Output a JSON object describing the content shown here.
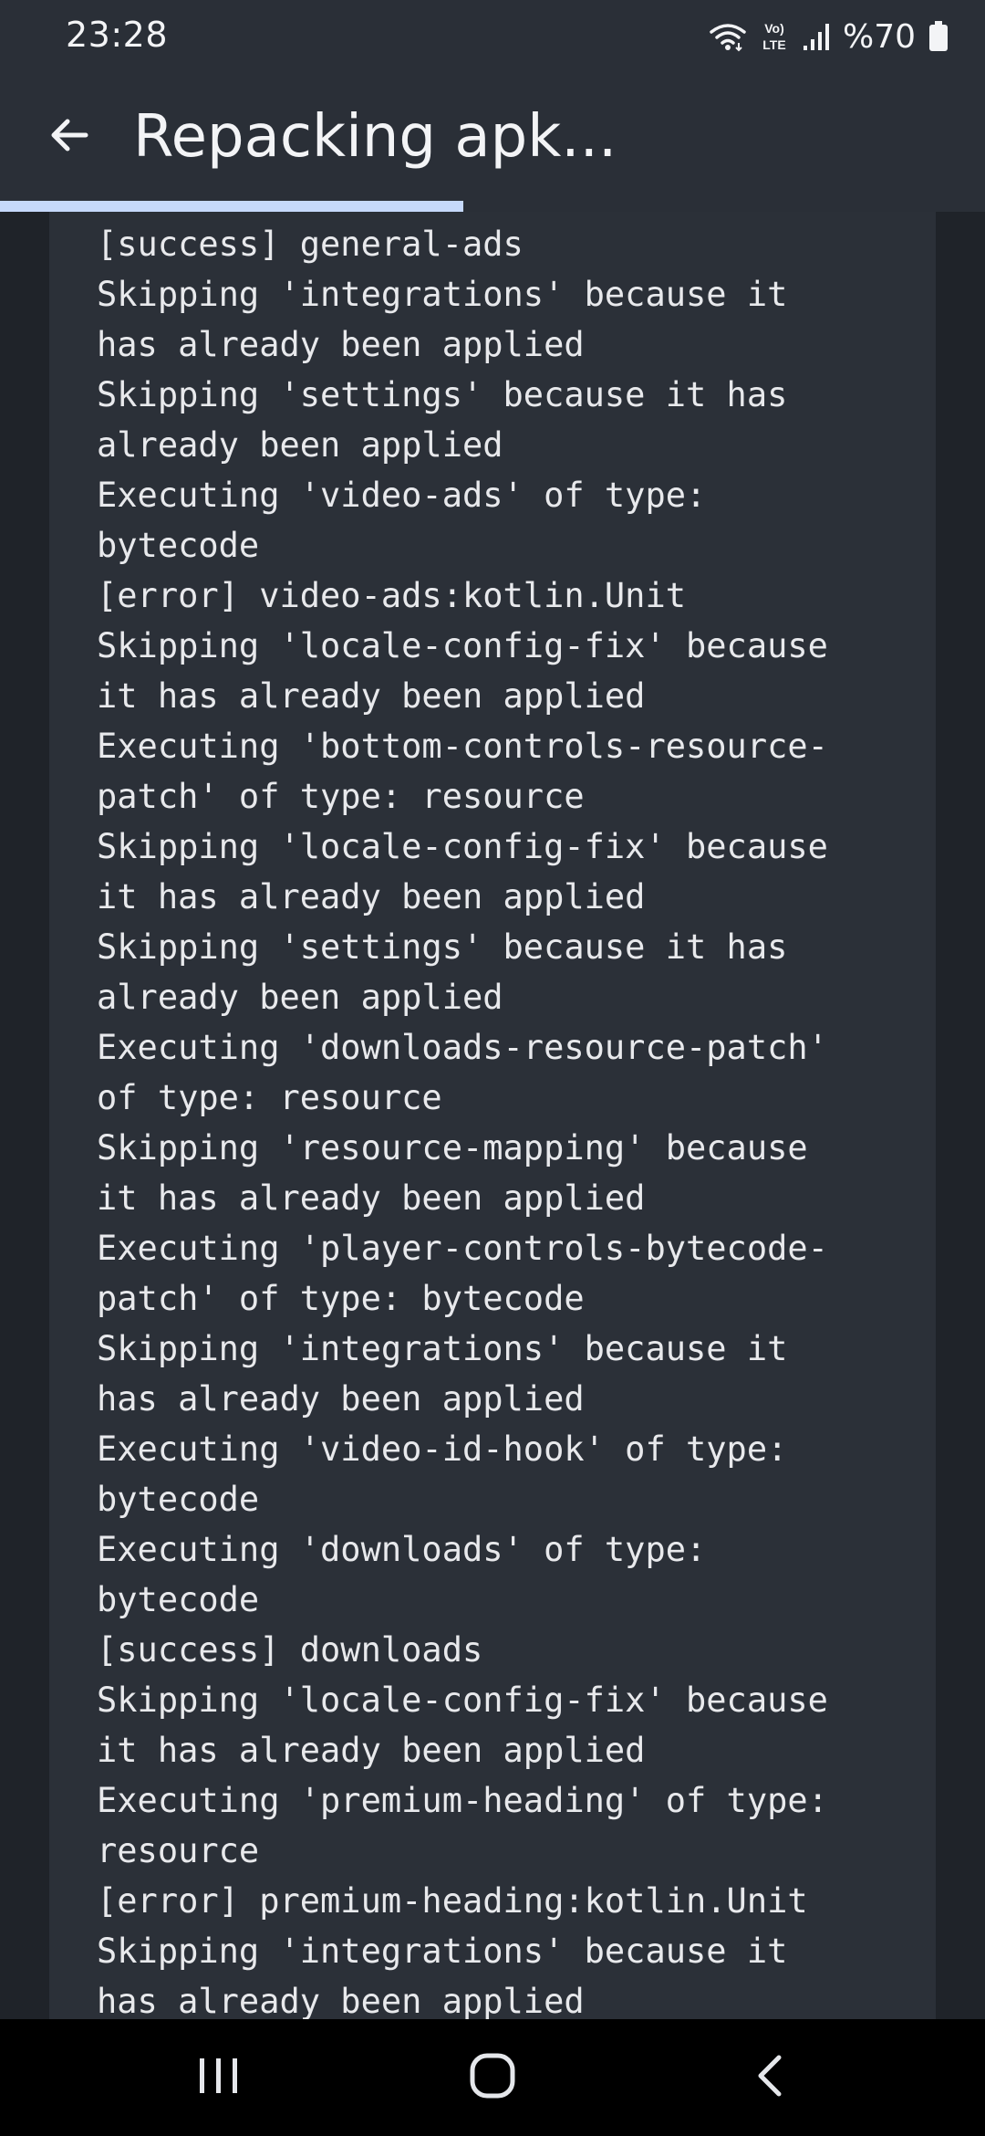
{
  "status_bar": {
    "time": "23:28",
    "battery_text": "%70",
    "icons": [
      "wifi-icon",
      "volte-icon",
      "signal-icon",
      "battery-icon"
    ]
  },
  "app_bar": {
    "title": "Repacking apk...",
    "back_icon": "arrow-left-icon"
  },
  "progress": {
    "value": 0.47,
    "color": "#c6d9fb"
  },
  "log": {
    "lines": [
      "[success] general-ads",
      "Skipping 'integrations' because it",
      "has already been applied",
      "Skipping 'settings' because it has",
      "already been applied",
      "Executing 'video-ads' of type:",
      "bytecode",
      "[error] video-ads:kotlin.Unit",
      "Skipping 'locale-config-fix' because",
      "it has already been applied",
      "Executing 'bottom-controls-resource-",
      "patch' of type: resource",
      "Skipping 'locale-config-fix' because",
      "it has already been applied",
      "Skipping 'settings' because it has",
      "already been applied",
      "Executing 'downloads-resource-patch'",
      "of type: resource",
      "Skipping 'resource-mapping' because",
      "it has already been applied",
      "Executing 'player-controls-bytecode-",
      "patch' of type: bytecode",
      "Skipping 'integrations' because it",
      "has already been applied",
      "Executing 'video-id-hook' of type:",
      "bytecode",
      "Executing 'downloads' of type:",
      "bytecode",
      "[success] downloads",
      "Skipping 'locale-config-fix' because",
      "it has already been applied",
      "Executing 'premium-heading' of type:",
      "resource",
      "[error] premium-heading:kotlin.Unit",
      "Skipping 'integrations' because it",
      "has already been applied"
    ]
  },
  "nav_bar": {
    "icons": [
      "recent-apps-icon",
      "home-icon",
      "back-icon"
    ]
  }
}
